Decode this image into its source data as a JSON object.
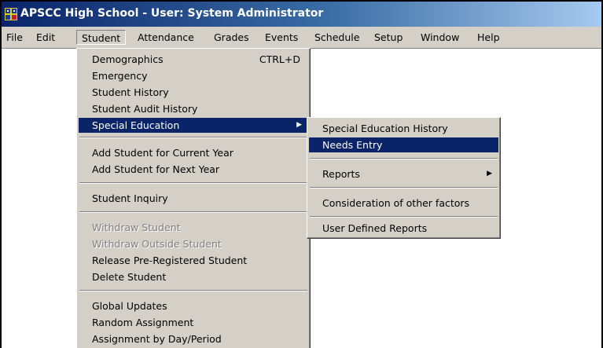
{
  "window": {
    "title": "APSCC High School - User: System Administrator",
    "icon": "app-logo-icon"
  },
  "menubar": {
    "items": [
      {
        "label": "File"
      },
      {
        "label": "Edit"
      },
      {
        "label": "Student",
        "open": true
      },
      {
        "label": "Attendance"
      },
      {
        "label": "Grades"
      },
      {
        "label": "Events"
      },
      {
        "label": "Schedule"
      },
      {
        "label": "Setup"
      },
      {
        "label": "Window"
      },
      {
        "label": "Help"
      }
    ]
  },
  "student_menu": {
    "items": [
      {
        "label": "Demographics",
        "shortcut": "CTRL+D"
      },
      {
        "label": "Emergency"
      },
      {
        "label": "Student History"
      },
      {
        "label": "Student Audit History"
      },
      {
        "label": "Special Education",
        "submenu": true,
        "highlighted": true
      },
      {
        "label": "Add Student for Current Year"
      },
      {
        "label": "Add Student for Next Year"
      },
      {
        "label": "Student Inquiry"
      },
      {
        "label": "Withdraw Student",
        "disabled": true
      },
      {
        "label": "Withdraw Outside Student",
        "disabled": true
      },
      {
        "label": "Release Pre-Registered Student"
      },
      {
        "label": "Delete Student"
      },
      {
        "label": "Global Updates"
      },
      {
        "label": "Random Assignment"
      },
      {
        "label": "Assignment by Day/Period"
      }
    ]
  },
  "special_education_submenu": {
    "items": [
      {
        "label": "Special Education History"
      },
      {
        "label": "Needs Entry",
        "highlighted": true
      },
      {
        "label": "Reports",
        "submenu": true
      },
      {
        "label": "Consideration of other factors"
      },
      {
        "label": "User Defined Reports"
      }
    ]
  },
  "colors": {
    "title_gradient_start": "#0a246a",
    "title_gradient_end": "#a6caf0",
    "menu_face": "#d4d0c8",
    "highlight": "#0a246a",
    "disabled_text": "#808080"
  }
}
